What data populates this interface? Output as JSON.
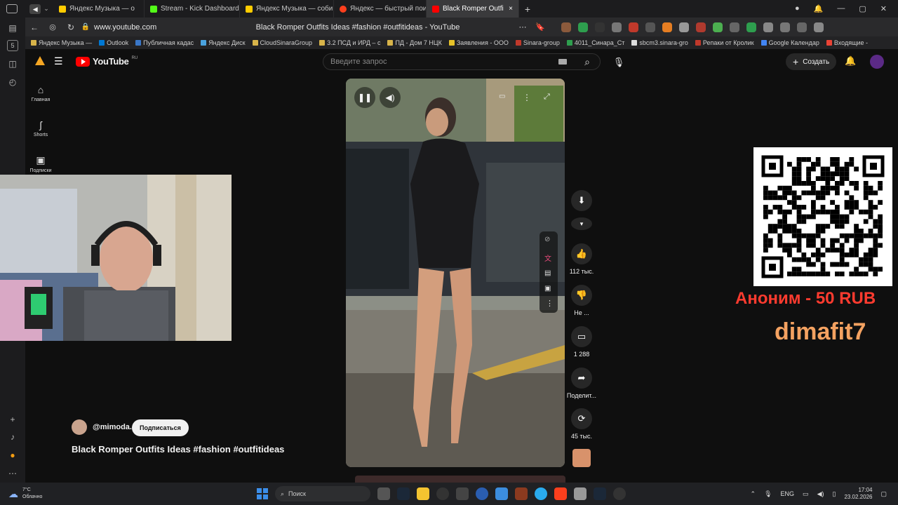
{
  "browser": {
    "tabs": [
      {
        "label": "Яндекс Музыка — о",
        "color": "#ffcc00"
      },
      {
        "label": "Stream - Kick Dashboard",
        "color": "#53fc18"
      },
      {
        "label": "Яндекс Музыка — собир",
        "color": "#ffcc00"
      },
      {
        "label": "Яндекс — быстрый поис",
        "color": "#fc3f1d"
      },
      {
        "label": "Black Romper Outfi",
        "color": "#ff0000",
        "active": true
      }
    ],
    "url": "www.youtube.com",
    "page_title": "Black Romper Outfits Ideas #fashion #outfitideas - YouTube",
    "bookmarks": [
      "Яндекс Музыка —",
      "Outlook",
      "Публичная кадас",
      "Яндекс Диск",
      "CloudSinaraGroup",
      "3.2 ПСД и ИРД – с",
      "ПД - Дом 7 НЦК",
      "Заявления - ООО",
      "Sinara-group",
      "4011_Синара_Ст",
      "sbcm3.sinara-gro",
      "Репаки от Кролик",
      "Google Календар",
      "Входящие -"
    ]
  },
  "youtube": {
    "logo_text": "YouTube",
    "logo_region": "RU",
    "search_placeholder": "Введите запрос",
    "create_label": "Создать",
    "nav": [
      {
        "label": "Главная",
        "icon": "home-icon"
      },
      {
        "label": "Shorts",
        "icon": "shorts-icon"
      },
      {
        "label": "Подписки",
        "icon": "subscriptions-icon"
      }
    ],
    "short": {
      "channel": "@mimoda.",
      "subscribe_label": "Подписаться",
      "title": "Black Romper Outfits Ideas #fashion #outfitideas"
    },
    "actions": {
      "likes": "112 тыс.",
      "dislike": "Не ...",
      "comments": "1 288",
      "share": "Поделит...",
      "remix": "45 тыс."
    }
  },
  "overlay": {
    "donate_text": "Аноним - 50 RUB",
    "donate_name": "dimafit7",
    "donate_color": "#ff3b2f",
    "name_color": "#f4a261"
  },
  "taskbar": {
    "weather_temp": "7°C",
    "weather_desc": "Облачно",
    "search_label": "Поиск",
    "lang": "ENG",
    "time": "17:04",
    "date": "23.02.2026"
  }
}
